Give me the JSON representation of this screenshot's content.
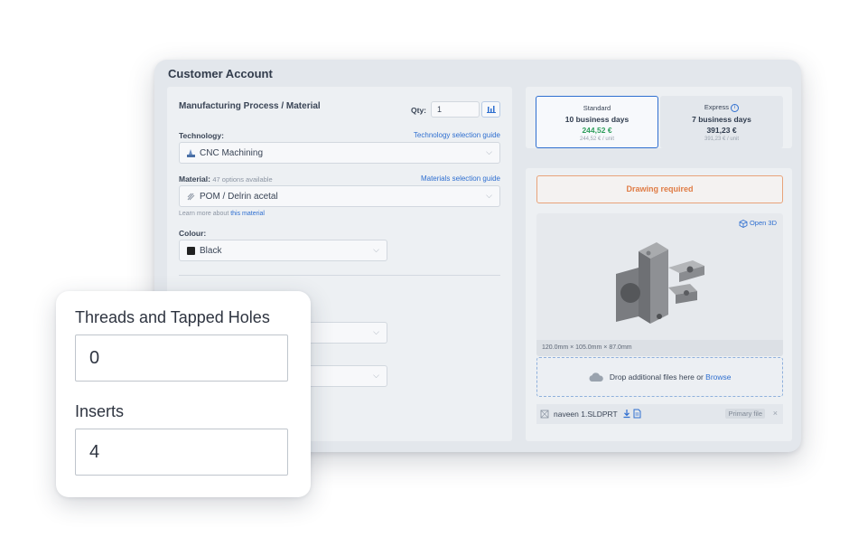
{
  "card": {
    "title": "Customer Account"
  },
  "process": {
    "heading": "Manufacturing Process / Material",
    "qty_label": "Qty:",
    "qty_value": "1",
    "technology_label": "Technology:",
    "technology_guide": "Technology selection guide",
    "technology_value": "CNC Machining",
    "material_label": "Material:",
    "material_count": "47 options available",
    "material_guide": "Materials selection guide",
    "material_value": "POM / Delrin acetal",
    "learn_more_prefix": "Learn more about",
    "learn_more_link": "this material",
    "colour_label": "Colour:",
    "colour_value": "Black",
    "colour_swatch": "#222222"
  },
  "delivery": {
    "standard": {
      "name": "Standard",
      "days": "10 business days",
      "price": "244,52 €",
      "unit": "244,52 € / unit",
      "price_color": "#2e9e5b"
    },
    "express": {
      "name": "Express",
      "days": "7 business days",
      "price": "391,23 €",
      "unit": "391,23 € / unit"
    }
  },
  "viewer": {
    "drawing_required": "Drawing required",
    "open_3d": "Open 3D",
    "dimensions": "120.0mm × 105.0mm × 87.0mm"
  },
  "upload": {
    "drop_text": "Drop additional files here or",
    "browse": "Browse"
  },
  "file": {
    "name": "naveen 1.SLDPRT",
    "badge": "Primary file"
  },
  "overlay": {
    "threads_label": "Threads and Tapped Holes",
    "threads_value": "0",
    "inserts_label": "Inserts",
    "inserts_value": "4"
  },
  "colors": {
    "accent": "#2f6fd0",
    "warning": "#e07c45"
  }
}
